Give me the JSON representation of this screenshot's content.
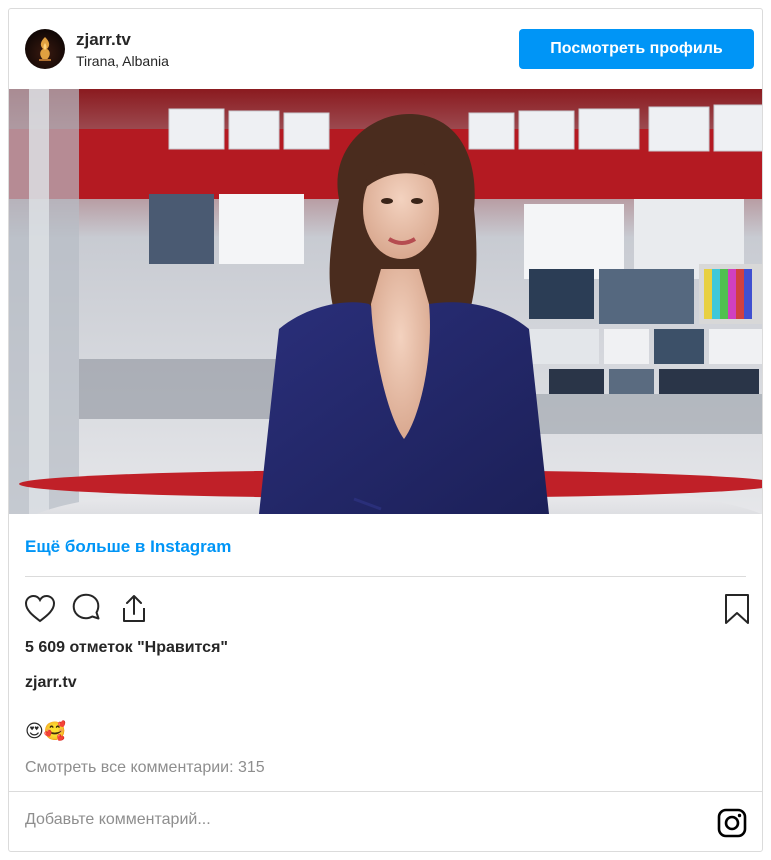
{
  "post": {
    "account": {
      "username": "zjarr.tv",
      "location": "Tirana, Albania",
      "avatar_icon": "zjarr-logo-icon"
    },
    "view_profile_label": "Посмотреть профиль",
    "media_description_icon": "news-studio-image",
    "more_on_instagram": "Ещё больше в Instagram",
    "actions": {
      "like_icon": "heart-icon",
      "comment_icon": "comment-icon",
      "share_icon": "share-icon",
      "save_icon": "bookmark-icon"
    },
    "likes_text": "5 609 отметок \"Нравится\"",
    "caption_username": "zjarr.tv",
    "caption_emojis": "😍🥰",
    "view_comments": "Смотреть все комментарии: 315",
    "add_comment_placeholder": "Добавьте комментарий...",
    "footer_icon": "instagram-icon"
  },
  "colors": {
    "accent": "#0095f6",
    "text": "#262626",
    "muted": "#8e8e8e",
    "border": "#dbdbdb"
  }
}
